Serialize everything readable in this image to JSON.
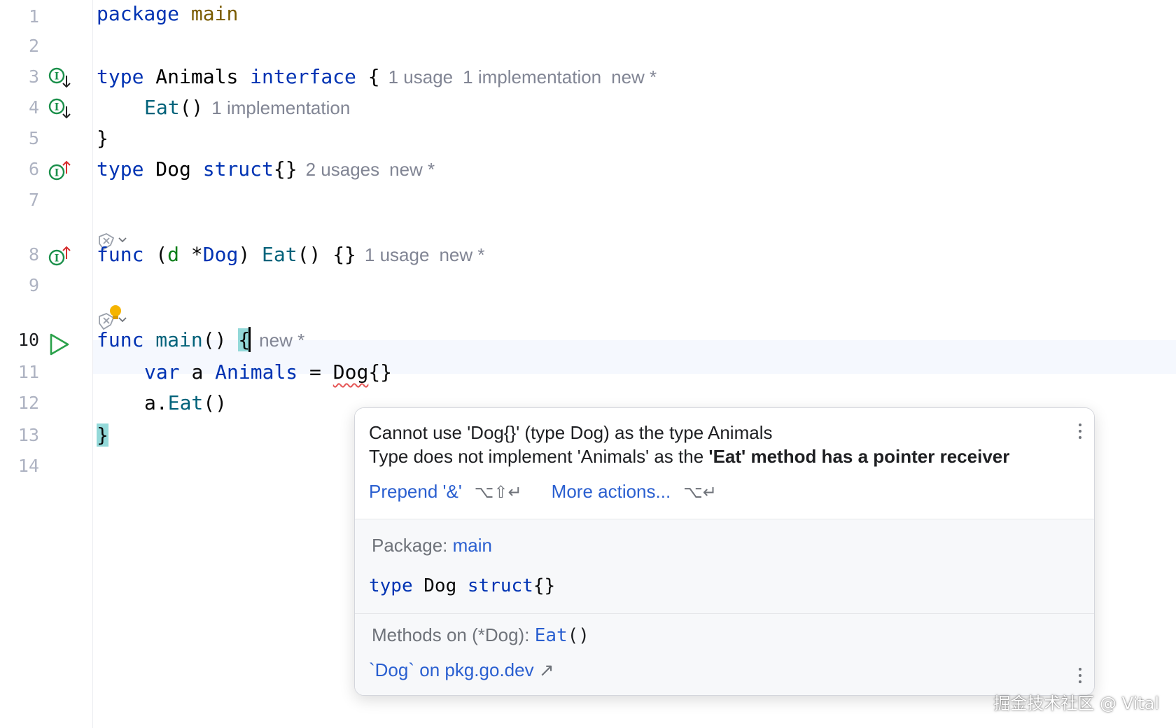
{
  "editor": {
    "line_numbers": [
      "1",
      "2",
      "3",
      "4",
      "5",
      "6",
      "7",
      "8",
      "9",
      "10",
      "11",
      "12",
      "13",
      "14"
    ],
    "lines": {
      "l1": {
        "kw": "package",
        "name": "main"
      },
      "l3": {
        "kw": "type",
        "name": "Animals",
        "kw2": "interface",
        "brace": "{",
        "hint1": "1 usage",
        "hint2": "1 implementation",
        "hint3": "new *"
      },
      "l4": {
        "fn": "Eat",
        "parens": "()",
        "hint1": "1 implementation"
      },
      "l5": {
        "brace": "}"
      },
      "l6": {
        "kw": "type",
        "name": "Dog",
        "kw2": "struct",
        "braces": "{}",
        "hint1": "2 usages",
        "hint2": "new *"
      },
      "l8": {
        "kw": "func",
        "open": "(",
        "recv": "d",
        "star": "*",
        "recv_type": "Dog",
        "close": ")",
        "fn": "Eat",
        "parens": "()",
        "braces": "{}",
        "hint1": "1 usage",
        "hint2": "new *"
      },
      "l10": {
        "kw": "func",
        "fn": "main",
        "parens": "()",
        "brace": "{",
        "hint1": "new *"
      },
      "l11": {
        "kw": "var",
        "name": "a",
        "type": "Animals",
        "eq": "=",
        "value": "Dog",
        "braces": "{}"
      },
      "l12": {
        "obj": "a.",
        "fn": "Eat",
        "parens": "()"
      },
      "l13": {
        "brace": "}"
      }
    },
    "colors": {
      "keyword": "#0033b3",
      "function": "#00627a",
      "hint": "#818594",
      "implement_icon": "#1a8f4a",
      "run_icon": "#2aa14a",
      "bulb": "#f5b400"
    }
  },
  "popup": {
    "message_line1": "Cannot use 'Dog{}' (type Dog) as the type Animals",
    "message_line2_prefix": "Type does not implement 'Animals' as the ",
    "message_line2_bold": "'Eat' method has a pointer receiver",
    "action1_label": "Prepend '&'",
    "action1_shortcut": "⌥⇧↵",
    "action2_label": "More actions...",
    "action2_shortcut": "⌥↵",
    "doc": {
      "package_label": "Package:",
      "package_name": "main",
      "sig_kw": "type",
      "sig_name": "Dog",
      "sig_kw2": "struct",
      "sig_braces": "{}",
      "methods_label": "Methods on (*Dog):",
      "method_name": "Eat",
      "method_parens": "()",
      "external_link": "`Dog` on pkg.go.dev",
      "external_arrow": "↗"
    }
  },
  "watermark": "掘金技术社区 @ Vital"
}
